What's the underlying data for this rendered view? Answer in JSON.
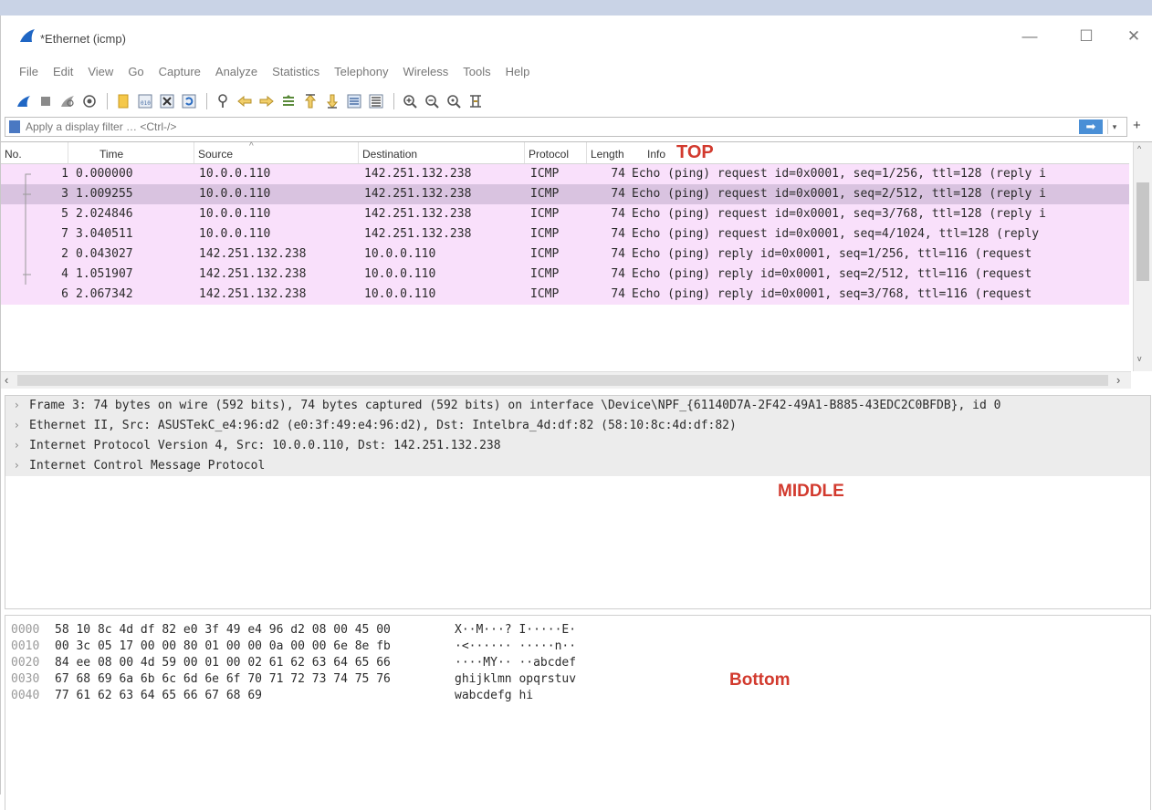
{
  "window": {
    "title": "*Ethernet (icmp)",
    "controls": {
      "minimize": "—",
      "maximize": "☐",
      "close": "✕"
    }
  },
  "menu": [
    "File",
    "Edit",
    "View",
    "Go",
    "Capture",
    "Analyze",
    "Statistics",
    "Telephony",
    "Wireless",
    "Tools",
    "Help"
  ],
  "toolbar_icons": [
    "start-capture-icon",
    "stop-capture-icon",
    "restart-capture-icon",
    "capture-options-icon",
    "open-file-icon",
    "save-file-icon",
    "close-file-icon",
    "reload-file-icon",
    "find-packet-icon",
    "go-back-icon",
    "go-forward-icon",
    "go-to-packet-icon",
    "first-packet-icon",
    "last-packet-icon",
    "auto-scroll-icon",
    "colorize-icon",
    "zoom-in-icon",
    "zoom-out-icon",
    "normal-size-icon",
    "resize-columns-icon"
  ],
  "filter": {
    "placeholder": "Apply a display filter … <Ctrl-/>",
    "plus": "+"
  },
  "packet_list": {
    "columns": [
      "No.",
      "Time",
      "Source",
      "Destination",
      "Protocol",
      "Length",
      "Info"
    ],
    "annotation": "TOP",
    "rows": [
      {
        "no": "1",
        "time": "0.000000",
        "src": "10.0.0.110",
        "dst": "142.251.132.238",
        "proto": "ICMP",
        "len": "74",
        "info": "Echo (ping) request  id=0x0001, seq=1/256, ttl=128 (reply i"
      },
      {
        "no": "3",
        "time": "1.009255",
        "src": "10.0.0.110",
        "dst": "142.251.132.238",
        "proto": "ICMP",
        "len": "74",
        "info": "Echo (ping) request  id=0x0001, seq=2/512, ttl=128 (reply i"
      },
      {
        "no": "5",
        "time": "2.024846",
        "src": "10.0.0.110",
        "dst": "142.251.132.238",
        "proto": "ICMP",
        "len": "74",
        "info": "Echo (ping) request  id=0x0001, seq=3/768, ttl=128 (reply i"
      },
      {
        "no": "7",
        "time": "3.040511",
        "src": "10.0.0.110",
        "dst": "142.251.132.238",
        "proto": "ICMP",
        "len": "74",
        "info": "Echo (ping) request  id=0x0001, seq=4/1024, ttl=128 (reply"
      },
      {
        "no": "2",
        "time": "0.043027",
        "src": "142.251.132.238",
        "dst": "10.0.0.110",
        "proto": "ICMP",
        "len": "74",
        "info": "Echo (ping) reply    id=0x0001, seq=1/256, ttl=116 (request"
      },
      {
        "no": "4",
        "time": "1.051907",
        "src": "142.251.132.238",
        "dst": "10.0.0.110",
        "proto": "ICMP",
        "len": "74",
        "info": "Echo (ping) reply    id=0x0001, seq=2/512, ttl=116 (request"
      },
      {
        "no": "6",
        "time": "2.067342",
        "src": "142.251.132.238",
        "dst": "10.0.0.110",
        "proto": "ICMP",
        "len": "74",
        "info": "Echo (ping) reply    id=0x0001, seq=3/768, ttl=116 (request"
      }
    ],
    "selected_no": "3"
  },
  "details": {
    "annotation": "MIDDLE",
    "rows": [
      "Frame 3: 74 bytes on wire (592 bits), 74 bytes captured (592 bits) on interface \\Device\\NPF_{61140D7A-2F42-49A1-B885-43EDC2C0BFDB}, id 0",
      "Ethernet II, Src: ASUSTekC_e4:96:d2 (e0:3f:49:e4:96:d2), Dst: Intelbra_4d:df:82 (58:10:8c:4d:df:82)",
      "Internet Protocol Version 4, Src: 10.0.0.110, Dst: 142.251.132.238",
      "Internet Control Message Protocol"
    ]
  },
  "bytes": {
    "annotation": "Bottom",
    "rows": [
      {
        "offset": "0000",
        "hex": "58 10 8c 4d df 82 e0 3f  49 e4 96 d2 08 00 45 00",
        "ascii": "X··M···? I·····E·"
      },
      {
        "offset": "0010",
        "hex": "00 3c 05 17 00 00 80 01  00 00 0a 00 00 6e 8e fb",
        "ascii": "·<······ ·····n··"
      },
      {
        "offset": "0020",
        "hex": "84 ee 08 00 4d 59 00 01  00 02 61 62 63 64 65 66",
        "ascii": "····MY·· ··abcdef"
      },
      {
        "offset": "0030",
        "hex": "67 68 69 6a 6b 6c 6d 6e  6f 70 71 72 73 74 75 76",
        "ascii": "ghijklmn opqrstuv"
      },
      {
        "offset": "0040",
        "hex": "77 61 62 63 64 65 66 67  68 69",
        "ascii": "wabcdefg hi"
      }
    ]
  },
  "colors": {
    "row_bg": "#f9e0fb",
    "row_selected_bg": "#d9c3e0",
    "annotation_red": "#d23a2e"
  }
}
